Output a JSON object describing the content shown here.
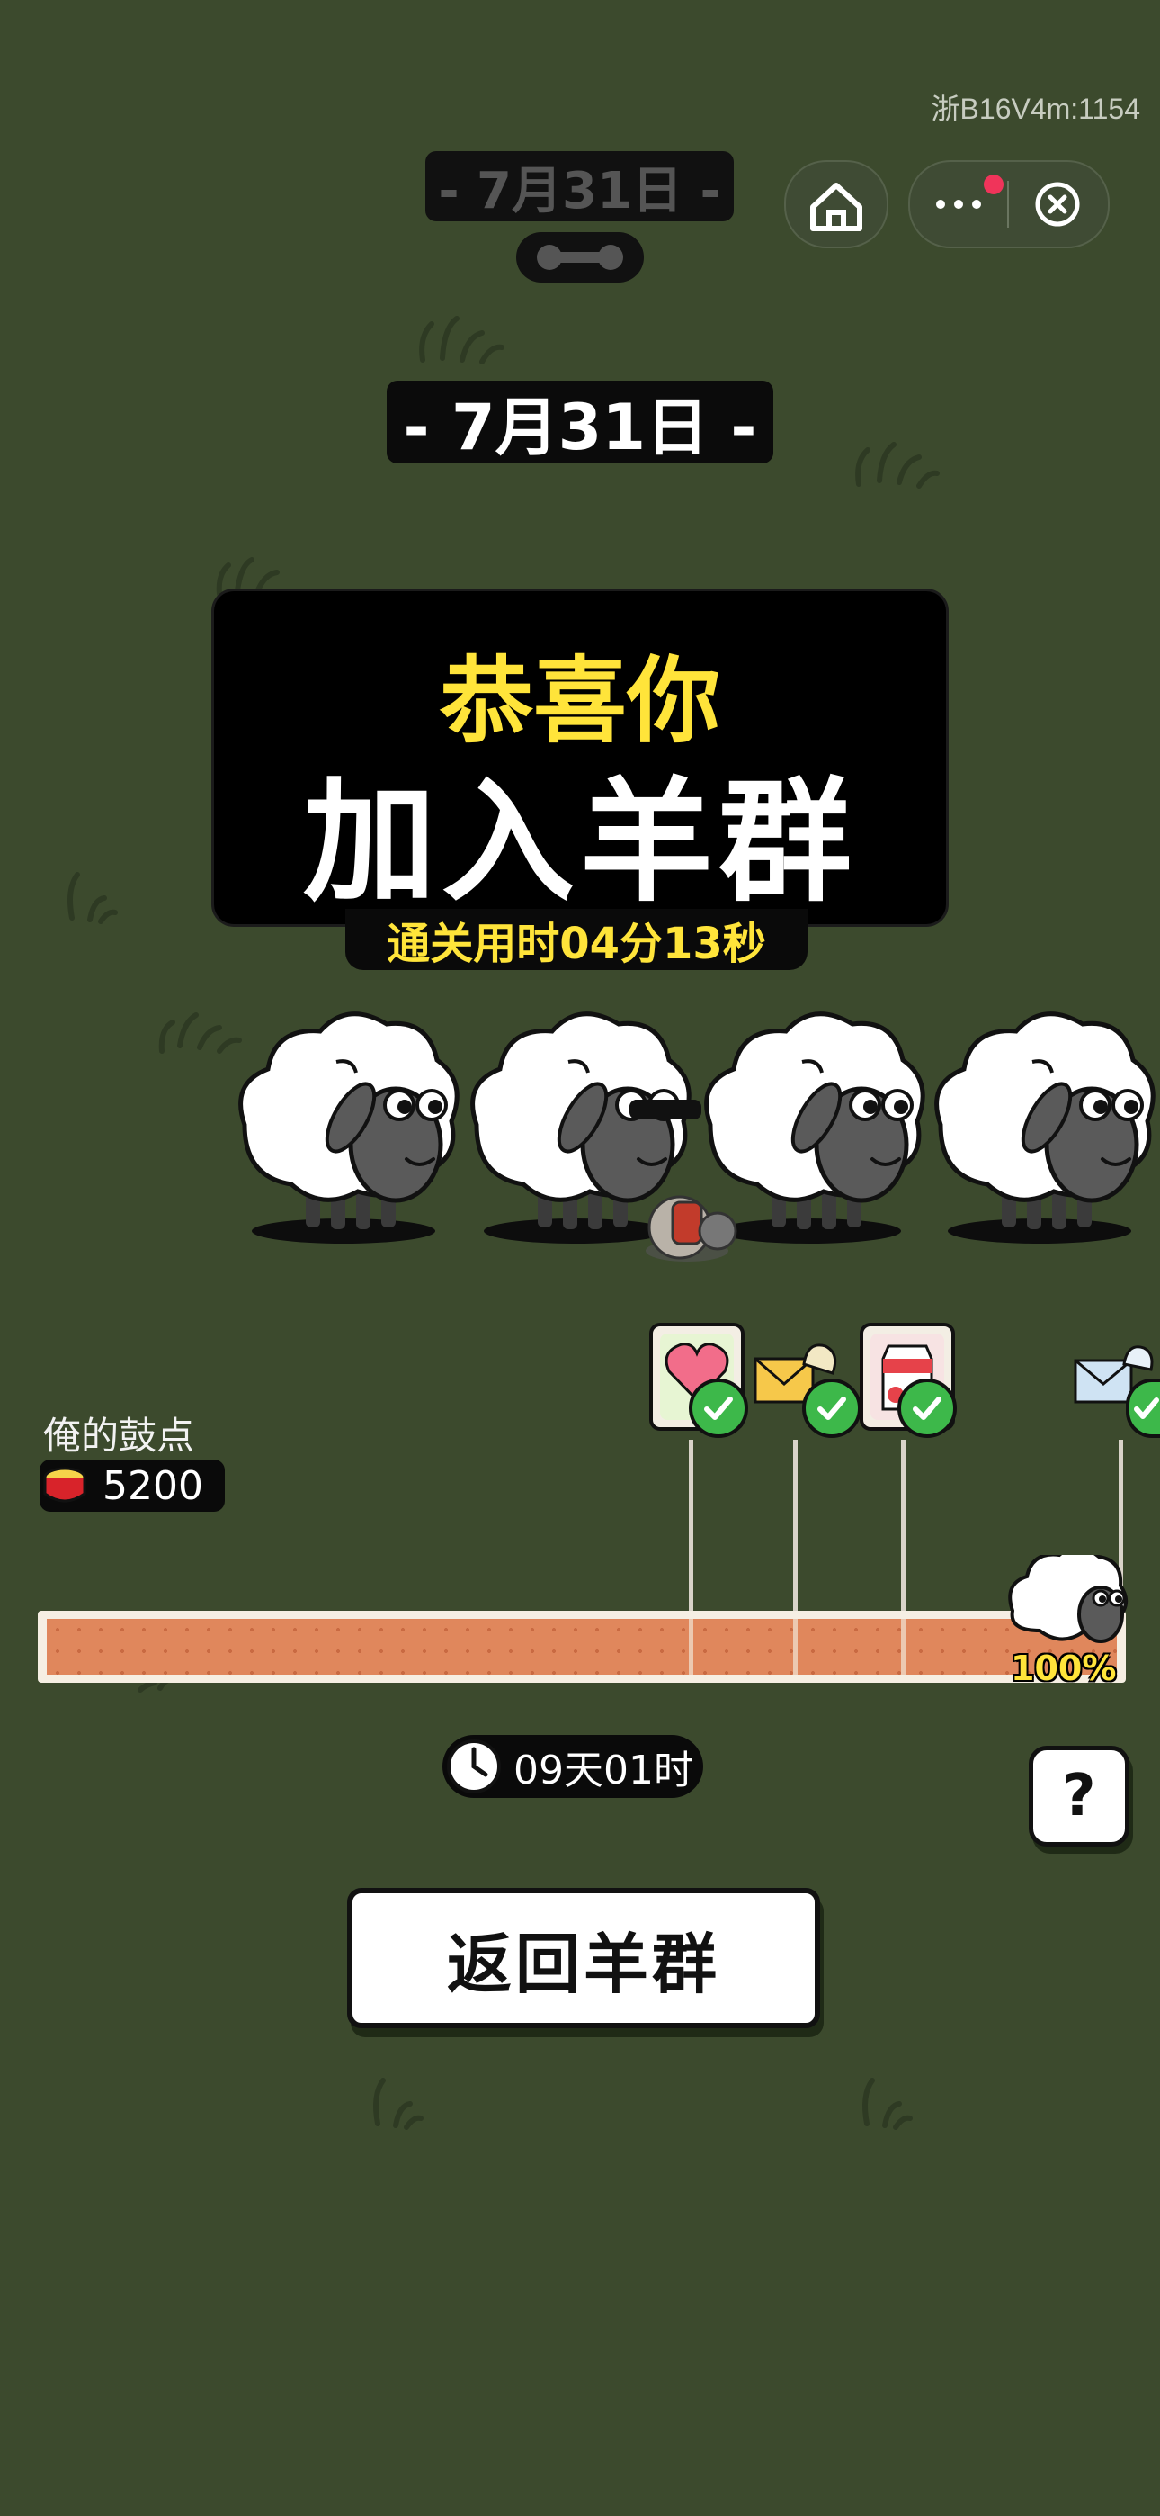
{
  "system": {
    "watermark": "浙B16V4m:1154",
    "top_date": "- 7月31日 -"
  },
  "header": {
    "date": "- 7月31日 -"
  },
  "banner": {
    "line1": "恭喜你",
    "line2": "加入羊群",
    "clear_time": "通关用时04分13秒"
  },
  "drum": {
    "label": "俺的鼓点",
    "value": "5200"
  },
  "progress": {
    "percent_label": "100%",
    "percent": 100,
    "rewards": [
      {
        "icon": "heart-shell-icon",
        "claimed": true
      },
      {
        "icon": "gold-envelope-icon",
        "claimed": true
      },
      {
        "icon": "strawberry-milk-icon",
        "claimed": true
      },
      {
        "icon": "blue-envelope-icon",
        "claimed": true
      }
    ]
  },
  "timer": {
    "remaining": "09天01时"
  },
  "help": {
    "label": "?"
  },
  "actions": {
    "return_label": "返回羊群"
  },
  "colors": {
    "background": "#3c4a2d",
    "accent_yellow": "#ffe43a",
    "progress_fill": "#e0875c",
    "check_green": "#3db84a",
    "notification_dot": "#f0345a"
  }
}
